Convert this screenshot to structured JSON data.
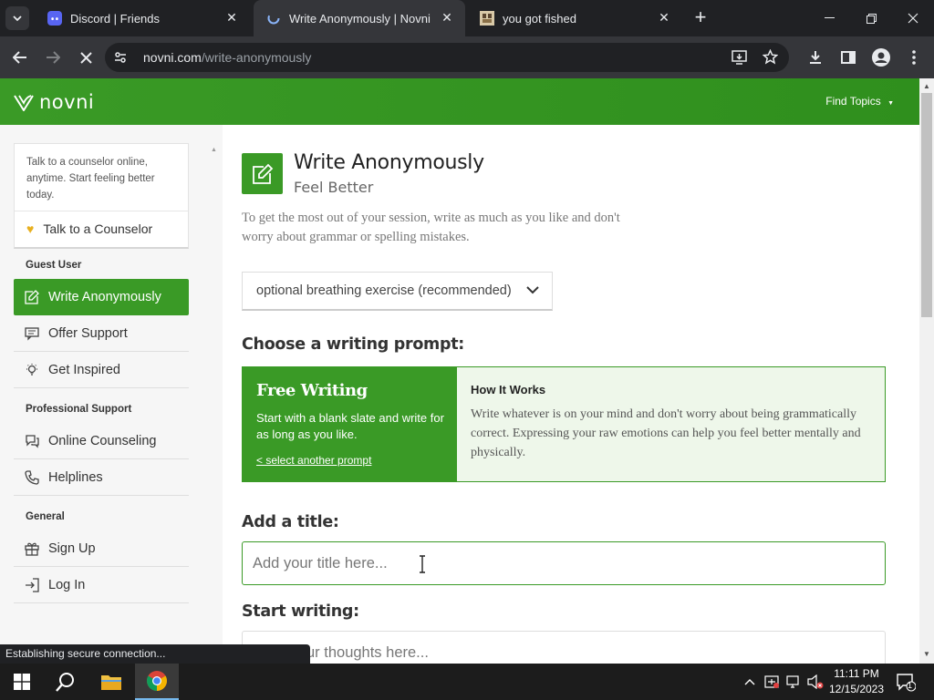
{
  "browser": {
    "tabs": [
      {
        "title": "Discord | Friends",
        "active": false,
        "icon": "discord-icon"
      },
      {
        "title": "Write Anonymously | Novni",
        "active": true,
        "icon": "loading-icon"
      },
      {
        "title": "you got fished",
        "active": false,
        "icon": "image-icon"
      }
    ],
    "url_host": "novni.com",
    "url_path": "/write-anonymously",
    "status": "Establishing secure connection..."
  },
  "site": {
    "logo_text": "novni",
    "find_topics": "Find Topics",
    "accent": "#3a9a26"
  },
  "sidebar": {
    "card_text": "Talk to a counselor online, anytime. Start feeling better today.",
    "card_link": "Talk to a Counselor",
    "guest_heading": "Guest User",
    "guest_items": [
      {
        "label": "Write Anonymously",
        "icon": "pencil-square-icon",
        "active": true
      },
      {
        "label": "Offer Support",
        "icon": "chat-icon",
        "active": false
      },
      {
        "label": "Get Inspired",
        "icon": "lightbulb-icon",
        "active": false
      }
    ],
    "pro_heading": "Professional Support",
    "pro_items": [
      {
        "label": "Online Counseling",
        "icon": "chat-bubbles-icon"
      },
      {
        "label": "Helplines",
        "icon": "phone-icon"
      }
    ],
    "general_heading": "General",
    "general_items": [
      {
        "label": "Sign Up",
        "icon": "gift-icon"
      },
      {
        "label": "Log In",
        "icon": "login-icon"
      }
    ]
  },
  "main": {
    "title": "Write Anonymously",
    "subtitle": "Feel Better",
    "intro": "To get the most out of your session, write as much as you like and don't worry about grammar or spelling mistakes.",
    "breathing_select": "optional breathing exercise (recommended)",
    "prompt_heading": "Choose a writing prompt:",
    "prompt": {
      "name": "Free Writing",
      "description": "Start with a blank slate and write for as long as you like.",
      "link": "< select another prompt",
      "how_title": "How It Works",
      "how_text": "Write whatever is on your mind and don't worry about being grammatically correct. Expressing your raw emotions can help you feel better mentally and physically."
    },
    "title_heading": "Add a title:",
    "title_placeholder": "Add your title here...",
    "writing_heading": "Start writing:",
    "writing_placeholder_visible": "ur thoughts here..."
  },
  "taskbar": {
    "time": "11:11 PM",
    "date": "12/15/2023",
    "notifications": "1"
  }
}
